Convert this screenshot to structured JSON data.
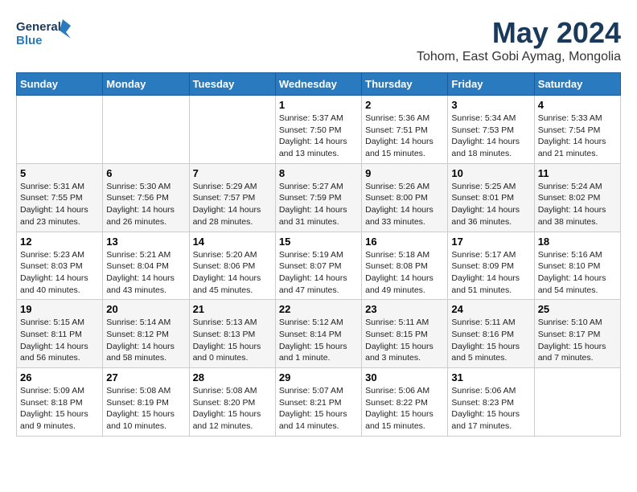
{
  "header": {
    "logo_line1": "General",
    "logo_line2": "Blue",
    "month": "May 2024",
    "location": "Tohom, East Gobi Aymag, Mongolia"
  },
  "weekdays": [
    "Sunday",
    "Monday",
    "Tuesday",
    "Wednesday",
    "Thursday",
    "Friday",
    "Saturday"
  ],
  "weeks": [
    [
      {
        "day": "",
        "info": ""
      },
      {
        "day": "",
        "info": ""
      },
      {
        "day": "",
        "info": ""
      },
      {
        "day": "1",
        "info": "Sunrise: 5:37 AM\nSunset: 7:50 PM\nDaylight: 14 hours\nand 13 minutes."
      },
      {
        "day": "2",
        "info": "Sunrise: 5:36 AM\nSunset: 7:51 PM\nDaylight: 14 hours\nand 15 minutes."
      },
      {
        "day": "3",
        "info": "Sunrise: 5:34 AM\nSunset: 7:53 PM\nDaylight: 14 hours\nand 18 minutes."
      },
      {
        "day": "4",
        "info": "Sunrise: 5:33 AM\nSunset: 7:54 PM\nDaylight: 14 hours\nand 21 minutes."
      }
    ],
    [
      {
        "day": "5",
        "info": "Sunrise: 5:31 AM\nSunset: 7:55 PM\nDaylight: 14 hours\nand 23 minutes."
      },
      {
        "day": "6",
        "info": "Sunrise: 5:30 AM\nSunset: 7:56 PM\nDaylight: 14 hours\nand 26 minutes."
      },
      {
        "day": "7",
        "info": "Sunrise: 5:29 AM\nSunset: 7:57 PM\nDaylight: 14 hours\nand 28 minutes."
      },
      {
        "day": "8",
        "info": "Sunrise: 5:27 AM\nSunset: 7:59 PM\nDaylight: 14 hours\nand 31 minutes."
      },
      {
        "day": "9",
        "info": "Sunrise: 5:26 AM\nSunset: 8:00 PM\nDaylight: 14 hours\nand 33 minutes."
      },
      {
        "day": "10",
        "info": "Sunrise: 5:25 AM\nSunset: 8:01 PM\nDaylight: 14 hours\nand 36 minutes."
      },
      {
        "day": "11",
        "info": "Sunrise: 5:24 AM\nSunset: 8:02 PM\nDaylight: 14 hours\nand 38 minutes."
      }
    ],
    [
      {
        "day": "12",
        "info": "Sunrise: 5:23 AM\nSunset: 8:03 PM\nDaylight: 14 hours\nand 40 minutes."
      },
      {
        "day": "13",
        "info": "Sunrise: 5:21 AM\nSunset: 8:04 PM\nDaylight: 14 hours\nand 43 minutes."
      },
      {
        "day": "14",
        "info": "Sunrise: 5:20 AM\nSunset: 8:06 PM\nDaylight: 14 hours\nand 45 minutes."
      },
      {
        "day": "15",
        "info": "Sunrise: 5:19 AM\nSunset: 8:07 PM\nDaylight: 14 hours\nand 47 minutes."
      },
      {
        "day": "16",
        "info": "Sunrise: 5:18 AM\nSunset: 8:08 PM\nDaylight: 14 hours\nand 49 minutes."
      },
      {
        "day": "17",
        "info": "Sunrise: 5:17 AM\nSunset: 8:09 PM\nDaylight: 14 hours\nand 51 minutes."
      },
      {
        "day": "18",
        "info": "Sunrise: 5:16 AM\nSunset: 8:10 PM\nDaylight: 14 hours\nand 54 minutes."
      }
    ],
    [
      {
        "day": "19",
        "info": "Sunrise: 5:15 AM\nSunset: 8:11 PM\nDaylight: 14 hours\nand 56 minutes."
      },
      {
        "day": "20",
        "info": "Sunrise: 5:14 AM\nSunset: 8:12 PM\nDaylight: 14 hours\nand 58 minutes."
      },
      {
        "day": "21",
        "info": "Sunrise: 5:13 AM\nSunset: 8:13 PM\nDaylight: 15 hours\nand 0 minutes."
      },
      {
        "day": "22",
        "info": "Sunrise: 5:12 AM\nSunset: 8:14 PM\nDaylight: 15 hours\nand 1 minute."
      },
      {
        "day": "23",
        "info": "Sunrise: 5:11 AM\nSunset: 8:15 PM\nDaylight: 15 hours\nand 3 minutes."
      },
      {
        "day": "24",
        "info": "Sunrise: 5:11 AM\nSunset: 8:16 PM\nDaylight: 15 hours\nand 5 minutes."
      },
      {
        "day": "25",
        "info": "Sunrise: 5:10 AM\nSunset: 8:17 PM\nDaylight: 15 hours\nand 7 minutes."
      }
    ],
    [
      {
        "day": "26",
        "info": "Sunrise: 5:09 AM\nSunset: 8:18 PM\nDaylight: 15 hours\nand 9 minutes."
      },
      {
        "day": "27",
        "info": "Sunrise: 5:08 AM\nSunset: 8:19 PM\nDaylight: 15 hours\nand 10 minutes."
      },
      {
        "day": "28",
        "info": "Sunrise: 5:08 AM\nSunset: 8:20 PM\nDaylight: 15 hours\nand 12 minutes."
      },
      {
        "day": "29",
        "info": "Sunrise: 5:07 AM\nSunset: 8:21 PM\nDaylight: 15 hours\nand 14 minutes."
      },
      {
        "day": "30",
        "info": "Sunrise: 5:06 AM\nSunset: 8:22 PM\nDaylight: 15 hours\nand 15 minutes."
      },
      {
        "day": "31",
        "info": "Sunrise: 5:06 AM\nSunset: 8:23 PM\nDaylight: 15 hours\nand 17 minutes."
      },
      {
        "day": "",
        "info": ""
      }
    ]
  ]
}
